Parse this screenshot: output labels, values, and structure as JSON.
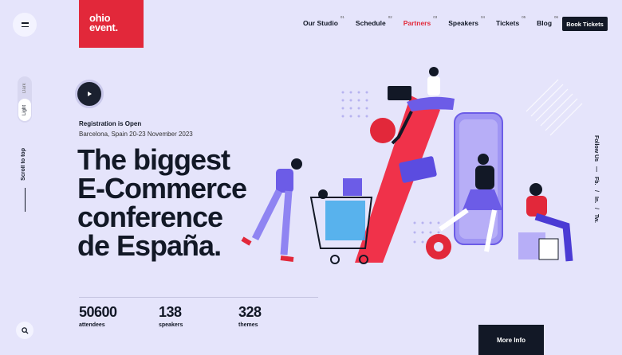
{
  "logo": {
    "line1": "ohio",
    "line2": "event."
  },
  "nav": {
    "items": [
      {
        "label": "Our Studio",
        "num": "01"
      },
      {
        "label": "Schedule",
        "num": "02"
      },
      {
        "label": "Partners",
        "num": "03",
        "active": true
      },
      {
        "label": "Speakers",
        "num": "04"
      },
      {
        "label": "Tickets",
        "num": "05"
      },
      {
        "label": "Blog",
        "num": "06"
      }
    ],
    "cta": "Book Tickets"
  },
  "sidebar": {
    "theme_dark": "Dark",
    "theme_light": "Light",
    "scroll_label": "Scroll to top"
  },
  "social": {
    "label": "Follow Us",
    "fb": "Fb.",
    "in": "In.",
    "tw": "Tw."
  },
  "hero": {
    "status": "Registration is Open",
    "location": "Barcelona, Spain 20-23 November 2023",
    "headline": [
      "The biggest",
      "E-Commerce",
      "conference",
      "de España."
    ]
  },
  "stats": [
    {
      "value": "50600",
      "label": "attendees"
    },
    {
      "value": "138",
      "label": "speakers"
    },
    {
      "value": "328",
      "label": "themes"
    }
  ],
  "more_info": "More Info",
  "colors": {
    "accent": "#e2283a",
    "dark": "#121826",
    "purple": "#6c5ce7",
    "bg": "#e5e4fb"
  }
}
